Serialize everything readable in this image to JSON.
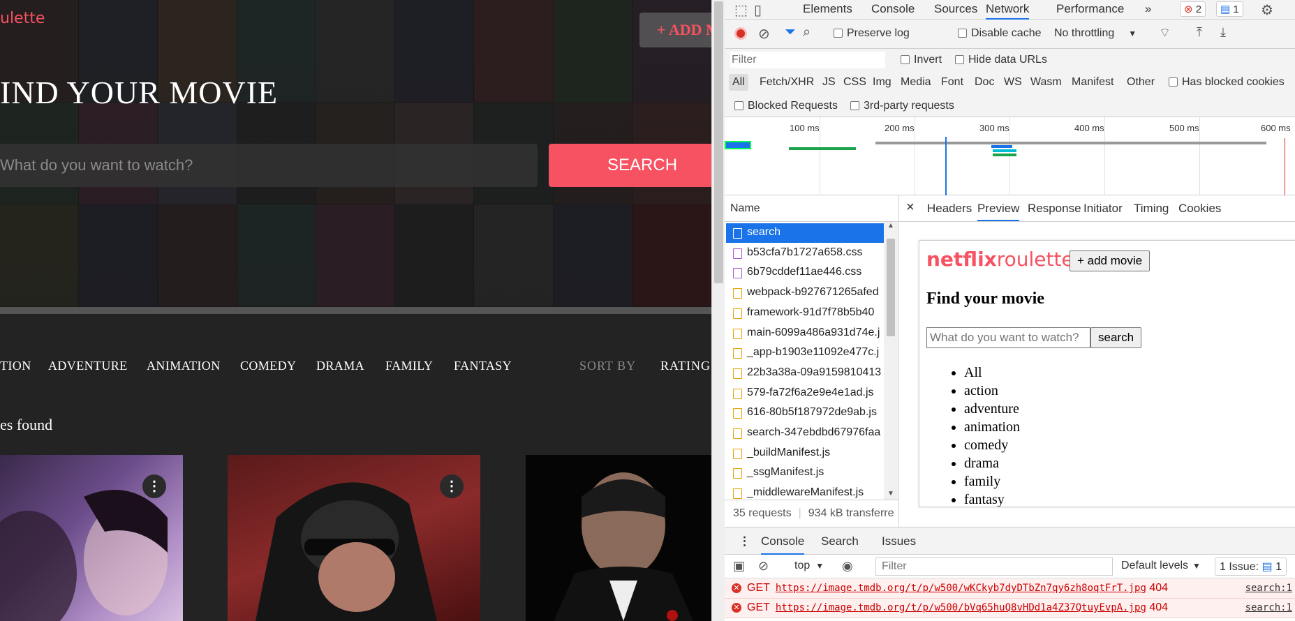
{
  "app": {
    "logo": "ulette",
    "add_button": "+ ADD MOVIE",
    "title": "IND YOUR MOVIE",
    "search_placeholder": "What do you want to watch?",
    "search_button": "SEARCH",
    "genres": [
      "TION",
      "ADVENTURE",
      "ANIMATION",
      "COMEDY",
      "DRAMA",
      "FAMILY",
      "FANTASY"
    ],
    "sort_label": "SORT BY",
    "sort_value": "RATING",
    "found_text": "es found"
  },
  "devtools": {
    "tabs": [
      "Elements",
      "Console",
      "Sources",
      "Network",
      "Performance"
    ],
    "active_tab": "Network",
    "more_tabs": "»",
    "error_count": "2",
    "message_count": "1",
    "preserve_log": "Preserve log",
    "disable_cache": "Disable cache",
    "throttling": "No throttling",
    "filter_placeholder": "Filter",
    "invert": "Invert",
    "hide_data_urls": "Hide data URLs",
    "types": [
      "All",
      "Fetch/XHR",
      "JS",
      "CSS",
      "Img",
      "Media",
      "Font",
      "Doc",
      "WS",
      "Wasm",
      "Manifest",
      "Other"
    ],
    "has_blocked_cookies": "Has blocked cookies",
    "blocked_requests": "Blocked Requests",
    "third_party": "3rd-party requests",
    "timeline_ticks": [
      "100 ms",
      "200 ms",
      "300 ms",
      "400 ms",
      "500 ms",
      "600 ms"
    ],
    "name_header": "Name",
    "requests": [
      {
        "name": "search",
        "type": "doc"
      },
      {
        "name": "b53cfa7b1727a658.css",
        "type": "css"
      },
      {
        "name": "6b79cddef11ae446.css",
        "type": "css"
      },
      {
        "name": "webpack-b927671265afed",
        "type": "js"
      },
      {
        "name": "framework-91d7f78b5b40",
        "type": "js"
      },
      {
        "name": "main-6099a486a931d74e.j",
        "type": "js"
      },
      {
        "name": "_app-b1903e11092e477c.j",
        "type": "js"
      },
      {
        "name": "22b3a38a-09a9159810413",
        "type": "js"
      },
      {
        "name": "579-fa72f6a2e9e4e1ad.js",
        "type": "js"
      },
      {
        "name": "616-80b5f187972de9ab.js",
        "type": "js"
      },
      {
        "name": "search-347ebdbd67976faa",
        "type": "js"
      },
      {
        "name": "_buildManifest.js",
        "type": "js"
      },
      {
        "name": "_ssgManifest.js",
        "type": "js"
      },
      {
        "name": "_middlewareManifest.js",
        "type": "js"
      }
    ],
    "request_count": "35 requests",
    "transferred": "934 kB transferre",
    "detail_tabs": [
      "Headers",
      "Preview",
      "Response",
      "Initiator",
      "Timing",
      "Cookies"
    ],
    "active_detail_tab": "Preview",
    "close_icon": "×",
    "preview": {
      "logo_bold": "netflix",
      "logo_rest": "roulette",
      "add_button": "+ add movie",
      "title": "Find your movie",
      "input_placeholder": "What do you want to watch?",
      "search_button": "search",
      "genres": [
        "All",
        "action",
        "adventure",
        "animation",
        "comedy",
        "drama",
        "family",
        "fantasy"
      ]
    },
    "drawer_tabs": [
      "Console",
      "Search",
      "Issues"
    ],
    "active_drawer_tab": "Console",
    "context": "top",
    "console_filter": "Filter",
    "default_levels": "Default levels",
    "issues_label": "1 Issue:",
    "issues_count": "1",
    "errors": [
      {
        "method": "GET",
        "url": "https://image.tmdb.org/t/p/w500/wKCkyb7dyDTbZn7qy6zh8oqtFrT.jpg",
        "status": "404",
        "source": "search:1"
      },
      {
        "method": "GET",
        "url": "https://image.tmdb.org/t/p/w500/bVq65huQ8vHDd1a4Z37QtuyEvpA.jpg",
        "status": "404",
        "source": "search:1"
      }
    ]
  },
  "colors": {
    "accent": "#f65261",
    "devtools_blue": "#1a73e8",
    "error_red": "#d93025"
  }
}
